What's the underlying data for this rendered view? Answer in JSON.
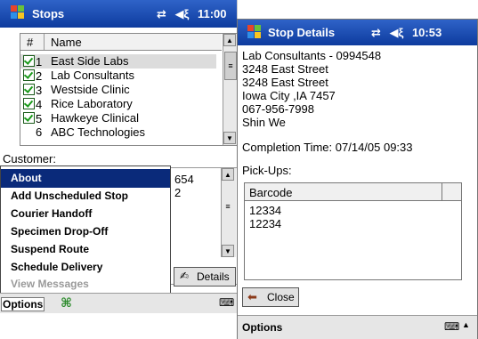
{
  "window1": {
    "title": "Stops",
    "time": "11:00",
    "grid": {
      "col_hash": "#",
      "col_name": "Name",
      "rows": [
        {
          "num": "1",
          "name": "East Side Labs",
          "checked": true
        },
        {
          "num": "2",
          "name": "Lab Consultants",
          "checked": true
        },
        {
          "num": "3",
          "name": "Westside Clinic",
          "checked": true
        },
        {
          "num": "4",
          "name": "Rice Laboratory",
          "checked": true
        },
        {
          "num": "5",
          "name": "Hawkeye Clinical",
          "checked": true
        },
        {
          "num": "6",
          "name": "ABC Technologies",
          "checked": false
        }
      ]
    },
    "customer_label": "Customer:",
    "values": [
      "654",
      "2"
    ],
    "details_button": "Details",
    "menu_items": [
      "About",
      "Add Unscheduled Stop",
      "Courier Handoff",
      "Specimen Drop-Off",
      "Suspend Route",
      "Schedule Delivery",
      "View Messages"
    ],
    "options_label": "Options"
  },
  "window2": {
    "title": "Stop Details",
    "time": "10:53",
    "lines": [
      "Lab Consultants - 0994548",
      "3248 East Street",
      "3248 East Street",
      "Iowa City ,IA  7457",
      "067-956-7998",
      "Shin We"
    ],
    "completion": "Completion Time: 07/14/05 09:33",
    "pickups_label": "Pick-Ups:",
    "barcode_header": "Barcode",
    "barcodes": [
      "12334",
      "12234"
    ],
    "close_button": "Close",
    "options_label": "Options"
  }
}
